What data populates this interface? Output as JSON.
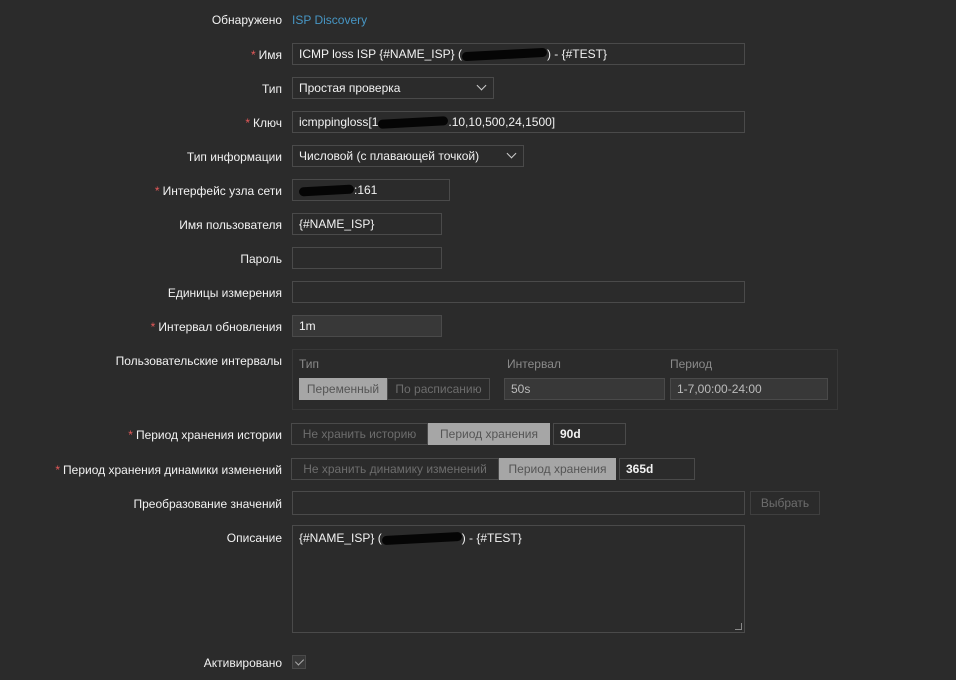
{
  "discovered": {
    "label": "Обнаружено",
    "value": "ISP Discovery"
  },
  "name": {
    "label": "Имя",
    "prefix": "ICMP loss ISP {#NAME_ISP} (",
    "suffix": ") - {#TEST}"
  },
  "type": {
    "label": "Тип",
    "value": "Простая проверка"
  },
  "key": {
    "label": "Ключ",
    "prefix": "icmppingloss[1",
    "suffix": ".10,10,500,24,1500]"
  },
  "info_type": {
    "label": "Тип информации",
    "value": "Числовой (с плавающей точкой)"
  },
  "interface": {
    "label": "Интерфейс узла сети",
    "suffix": ":161"
  },
  "username": {
    "label": "Имя пользователя",
    "value": "{#NAME_ISP}"
  },
  "password": {
    "label": "Пароль",
    "value": ""
  },
  "units": {
    "label": "Единицы измерения",
    "value": ""
  },
  "update_interval": {
    "label": "Интервал обновления",
    "value": "1m"
  },
  "custom_intervals": {
    "label": "Пользовательские интервалы",
    "col_type": "Тип",
    "col_interval": "Интервал",
    "col_period": "Период",
    "opt_flexible": "Переменный",
    "opt_scheduling": "По расписанию",
    "interval": "50s",
    "period": "1-7,00:00-24:00"
  },
  "history": {
    "label": "Период хранения истории",
    "opt_none": "Не хранить историю",
    "opt_period": "Период хранения",
    "value": "90d"
  },
  "trends": {
    "label": "Период хранения динамики изменений",
    "opt_none": "Не хранить динамику изменений",
    "opt_period": "Период хранения",
    "value": "365d"
  },
  "valuemap": {
    "label": "Преобразование значений",
    "value": "",
    "button": "Выбрать"
  },
  "description": {
    "label": "Описание",
    "prefix": "{#NAME_ISP} (",
    "suffix": ") - {#TEST}"
  },
  "enabled": {
    "label": "Активировано",
    "checked": true
  }
}
